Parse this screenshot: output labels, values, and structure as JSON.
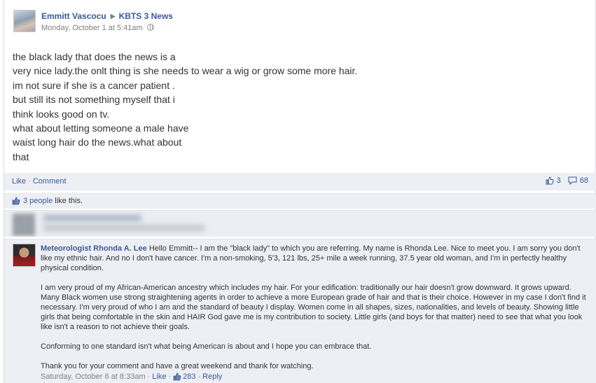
{
  "post": {
    "author": "Emmitt Vascocu",
    "target": "KBTS 3 News",
    "timestamp": "Monday, October 1 at 5:41am",
    "body_lines": [
      "the black lady that does the news is a",
      "very nice lady.the onlt thing is she needs to wear a wig or grow some more hair.",
      "im not sure if she is a cancer patient .",
      "but still its not something myself that i",
      "think looks good on tv.",
      "what about letting someone a male have",
      "waist long hair do the news.what about",
      "that"
    ]
  },
  "actions": {
    "like": "Like",
    "comment": "Comment",
    "like_count": "3",
    "comment_count": "68"
  },
  "likes_summary": {
    "people": "3 people",
    "suffix": "like this."
  },
  "comment": {
    "author": "Meteorologist Rhonda A. Lee",
    "paragraph1": "Hello Emmitt-- I am the \"black lady\" to which you are referring. My name is Rhonda Lee. Nice to meet you. I am sorry you don't like my ethnic hair. And no I don't have cancer. I'm a non-smoking, 5'3, 121 lbs, 25+ mile a week running, 37.5 year old woman, and I'm in perfectly healthy physical condition.",
    "paragraph2": "I am very proud of my African-American ancestry which includes my hair. For your edification: traditionally our hair doesn't grow downward. It grows upward. Many Black women use strong straightening agents in order to achieve a more European grade of hair and that is their choice. However in my case I don't find it necessary. I'm very proud of who I am and the standard of beauty I display. Women come in all shapes, sizes, nationalities, and levels of beauty. Showing little girls that being comfortable in the skin and HAIR God gave me is my contribution to society. Little girls (and boys for that matter) need to see that what you look like isn't a reason to not achieve their goals.",
    "paragraph3": "Conforming to one standard isn't what being American is about and I hope you can embrace that.",
    "paragraph4": "Thank you for your comment and have a great weekend and thank for watching.",
    "timestamp": "Saturday, October 6 at 8:33am",
    "like": "Like",
    "like_count": "283",
    "reply": "Reply"
  },
  "colors": {
    "link": "#3b5998",
    "meta": "#808080",
    "panel": "#edeff4"
  },
  "icons": {
    "globe": "globe-icon",
    "thumbs_up": "thumbs-up-icon",
    "comment_bubble": "comment-bubble-icon"
  }
}
